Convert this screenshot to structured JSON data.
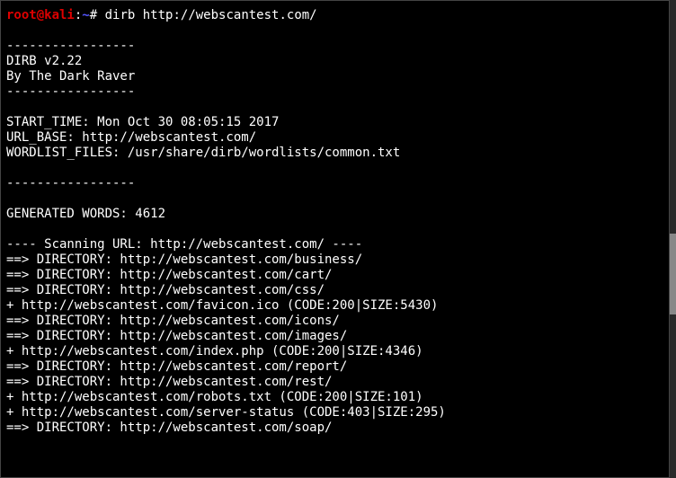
{
  "prompt": {
    "user": "root@kali",
    "separator": ":",
    "path": "~",
    "symbol": "#",
    "command": "dirb http://webscantest.com/"
  },
  "output": {
    "sep1": "-----------------",
    "version": "DIRB v2.22    ",
    "author": "By The Dark Raver",
    "sep2": "-----------------",
    "start_time": "START_TIME: Mon Oct 30 08:05:15 2017",
    "url_base": "URL_BASE: http://webscantest.com/",
    "wordlist": "WORDLIST_FILES: /usr/share/dirb/wordlists/common.txt",
    "sep3": "-----------------",
    "generated": "GENERATED WORDS: 4612                                                          ",
    "scanning": "---- Scanning URL: http://webscantest.com/ ----",
    "results": [
      "==> DIRECTORY: http://webscantest.com/business/",
      "==> DIRECTORY: http://webscantest.com/cart/",
      "==> DIRECTORY: http://webscantest.com/css/",
      "+ http://webscantest.com/favicon.ico (CODE:200|SIZE:5430)",
      "==> DIRECTORY: http://webscantest.com/icons/",
      "==> DIRECTORY: http://webscantest.com/images/",
      "+ http://webscantest.com/index.php (CODE:200|SIZE:4346)",
      "==> DIRECTORY: http://webscantest.com/report/",
      "==> DIRECTORY: http://webscantest.com/rest/",
      "+ http://webscantest.com/robots.txt (CODE:200|SIZE:101)",
      "+ http://webscantest.com/server-status (CODE:403|SIZE:295)",
      "==> DIRECTORY: http://webscantest.com/soap/"
    ]
  }
}
